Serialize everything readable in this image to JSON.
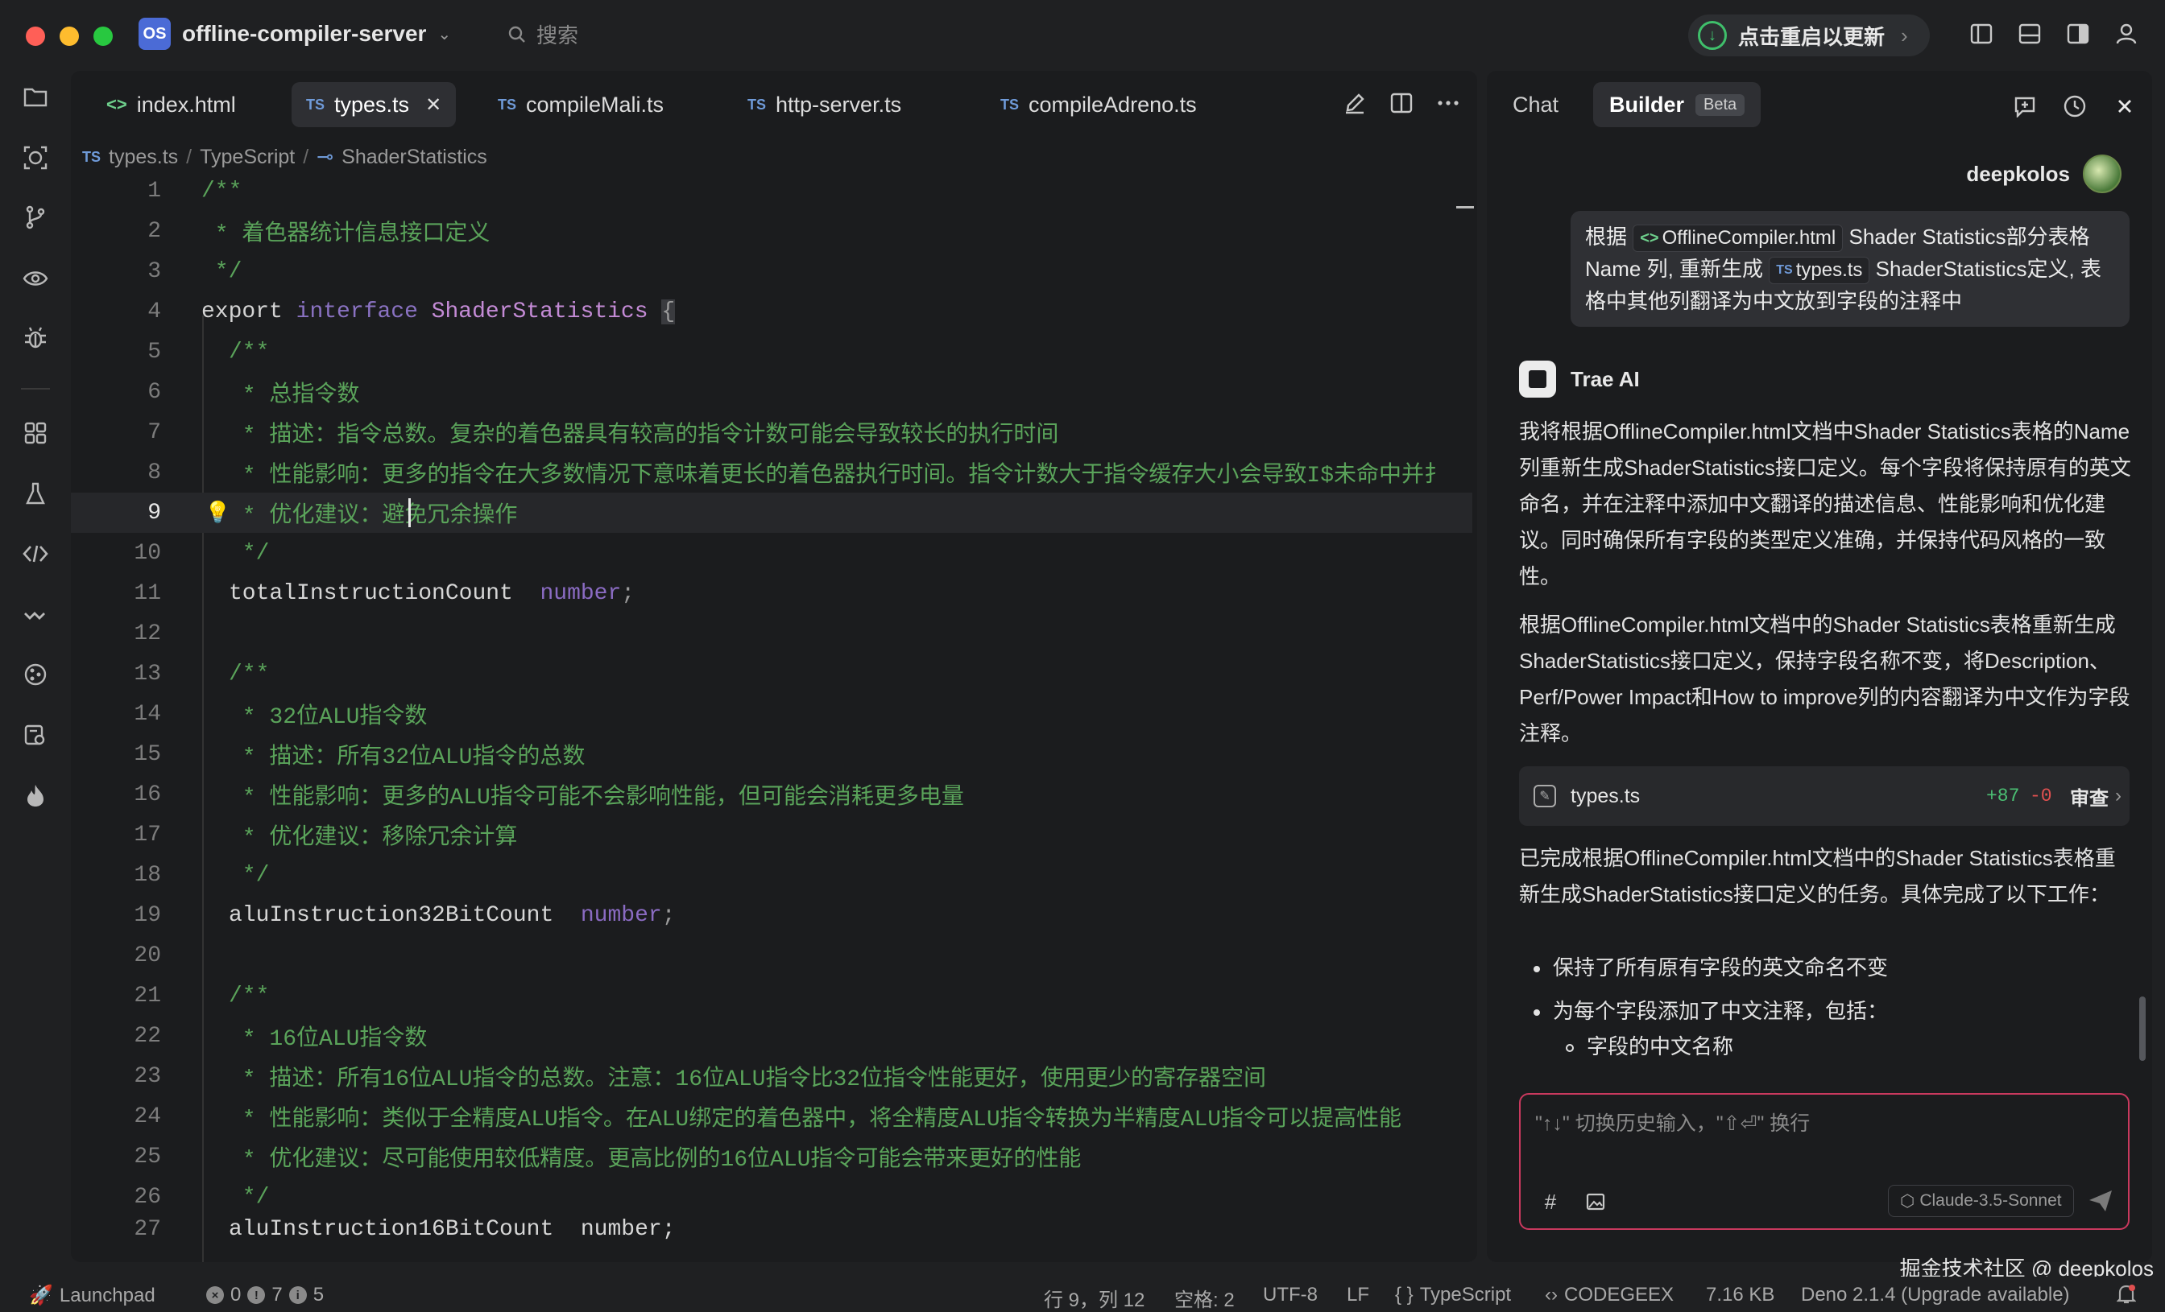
{
  "window": {
    "project_badge": "OS",
    "project_name": "offline-compiler-server",
    "search_placeholder": "搜索",
    "update_label": "点击重启以更新"
  },
  "editor": {
    "tabs": [
      {
        "label": "index.html",
        "kind": "html"
      },
      {
        "label": "types.ts",
        "kind": "ts",
        "active": true
      },
      {
        "label": "compileMali.ts",
        "kind": "ts"
      },
      {
        "label": "http-server.ts",
        "kind": "ts"
      },
      {
        "label": "compileAdreno.ts",
        "kind": "ts"
      }
    ],
    "ts_badge": "TS",
    "html_badge": "<>",
    "breadcrumb": {
      "file": "types.ts",
      "lang": "TypeScript",
      "symbol": "ShaderStatistics"
    },
    "current_line": 9,
    "lines": [
      {
        "n": "1"
      },
      {
        "n": "2"
      },
      {
        "n": "3"
      },
      {
        "n": "4"
      },
      {
        "n": "5"
      },
      {
        "n": "6"
      },
      {
        "n": "7"
      },
      {
        "n": "8"
      },
      {
        "n": "9"
      },
      {
        "n": "10"
      },
      {
        "n": "11"
      },
      {
        "n": "12"
      },
      {
        "n": "13"
      },
      {
        "n": "14"
      },
      {
        "n": "15"
      },
      {
        "n": "16"
      },
      {
        "n": "17"
      },
      {
        "n": "18"
      },
      {
        "n": "19"
      },
      {
        "n": "20"
      },
      {
        "n": "21"
      },
      {
        "n": "22"
      },
      {
        "n": "23"
      },
      {
        "n": "24"
      },
      {
        "n": "25"
      },
      {
        "n": "26"
      },
      {
        "n": "27"
      }
    ],
    "code": {
      "l1": "/**",
      "l2": " * 着色器统计信息接口定义",
      "l3": " */",
      "l4_kw": "export",
      "l4_kw2": "interface",
      "l4_type": "ShaderStatistics",
      "l4_brace": "{",
      "l5": "/**",
      "l6": " * 总指令数",
      "l7": " * 描述：指令总数。复杂的着色器具有较高的指令计数可能会导致较长的执行时间",
      "l8": " * 性能影响：更多的指令在大多数情况下意味着更长的着色器执行时间。指令计数大于指令缓存大小会导致I$未命中并扌",
      "l9": " * 优化建议：避免冗余操作",
      "l10": " */",
      "l11_name": "totalInstructionCount",
      "l11_type": "number",
      "l11_semi": ";",
      "l13": "/**",
      "l14": " * 32位ALU指令数",
      "l15": " * 描述：所有32位ALU指令的总数",
      "l16": " * 性能影响：更多的ALU指令可能不会影响性能，但可能会消耗更多电量",
      "l17": " * 优化建议：移除冗余计算",
      "l18": " */",
      "l19_name": "aluInstruction32BitCount",
      "l19_type": "number",
      "l19_semi": ";",
      "l21": "/**",
      "l22": " * 16位ALU指令数",
      "l23": " * 描述：所有16位ALU指令的总数。注意：16位ALU指令比32位指令性能更好，使用更少的寄存器空间",
      "l24": " * 性能影响：类似于全精度ALU指令。在ALU绑定的着色器中，将全精度ALU指令转换为半精度ALU指令可以提高性能",
      "l25": " * 优化建议：尽可能使用较低精度。更高比例的16位ALU指令可能会带来更好的性能",
      "l26": " */",
      "l27": "aluInstruction16BitCount  number;"
    }
  },
  "panel": {
    "tab_chat": "Chat",
    "tab_builder": "Builder",
    "beta": "Beta",
    "user_name": "deepkolos",
    "user_msg": {
      "p1": "根据",
      "chip1": "OfflineCompiler.html",
      "p2": " Shader Statistics部分表格 Name 列, 重新生成 ",
      "chip2": "types.ts",
      "p3": " ShaderStatistics定义, 表格中其他列翻译为中文放到字段的注释中"
    },
    "ai_name": "Trae AI",
    "ai_p1": "我将根据OfflineCompiler.html文档中Shader Statistics表格的Name列重新生成ShaderStatistics接口定义。每个字段将保持原有的英文命名，并在注释中添加中文翻译的描述信息、性能影响和优化建议。同时确保所有字段的类型定义准确，并保持代码风格的一致性。",
    "ai_p2": "根据OfflineCompiler.html文档中的Shader Statistics表格重新生成ShaderStatistics接口定义，保持字段名称不变，将Description、Perf/Power Impact和How to improve列的内容翻译为中文作为字段注释。",
    "file_card": {
      "name": "types.ts",
      "adds": "+87",
      "dels": "-0",
      "review": "审查"
    },
    "ai_p3": "已完成根据OfflineCompiler.html文档中的Shader Statistics表格重新生成ShaderStatistics接口定义的任务。具体完成了以下工作：",
    "bullets": [
      "保持了所有原有字段的英文命名不变",
      "为每个字段添加了中文注释，包括："
    ],
    "sub_bullets": [
      "字段的中文名称"
    ],
    "input_placeholder": "\"↑↓\" 切换历史输入，\"⇧⏎\" 换行",
    "model": "Claude-3.5-Sonnet",
    "watermark": "掘金技术社区 @ deepkolos"
  },
  "statusbar": {
    "launchpad": "Launchpad",
    "errors": "0",
    "warnings": "7",
    "infos": "5",
    "position": "行 9，列 12",
    "spaces": "空格: 2",
    "encoding": "UTF-8",
    "eol": "LF",
    "language": "TypeScript",
    "codegeex": "CODEGEEX",
    "filesize": "7.16 KB",
    "runtime": "Deno 2.1.4 (Upgrade available)"
  },
  "colors": {
    "accent_input_border": "#c9395e",
    "comment": "#5aa35a",
    "keyword_interface": "#8a72c2",
    "type_name": "#c48bd6",
    "update_green": "#3fbf6b"
  },
  "icons": {
    "activity": [
      "files-icon",
      "search-code-icon",
      "source-control-icon",
      "eye-icon",
      "debug-icon",
      "extensions-icon",
      "flask-icon",
      "code-icon",
      "wave-icon",
      "git-icon",
      "settings-search-icon",
      "flame-icon"
    ]
  }
}
